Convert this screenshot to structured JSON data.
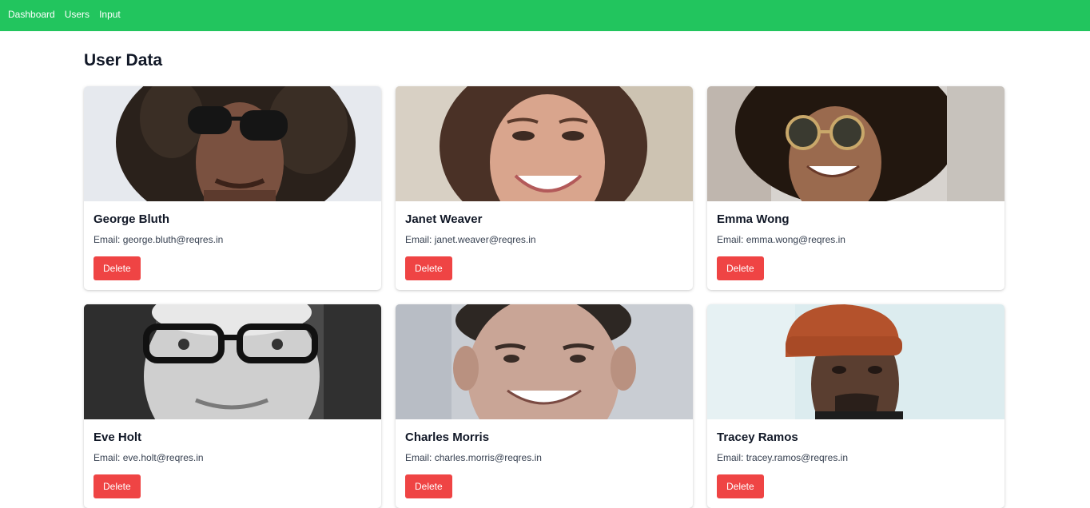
{
  "nav": {
    "items": [
      {
        "label": "Dashboard"
      },
      {
        "label": "Users"
      },
      {
        "label": "Input"
      }
    ]
  },
  "page": {
    "title": "User Data"
  },
  "colors": {
    "navbar": "#22c55e",
    "delete": "#ef4444"
  },
  "users": [
    {
      "name": "George Bluth",
      "email_label": "Email:",
      "email": "george.bluth@reqres.in",
      "delete_label": "Delete"
    },
    {
      "name": "Janet Weaver",
      "email_label": "Email:",
      "email": "janet.weaver@reqres.in",
      "delete_label": "Delete"
    },
    {
      "name": "Emma Wong",
      "email_label": "Email:",
      "email": "emma.wong@reqres.in",
      "delete_label": "Delete"
    },
    {
      "name": "Eve Holt",
      "email_label": "Email:",
      "email": "eve.holt@reqres.in",
      "delete_label": "Delete"
    },
    {
      "name": "Charles Morris",
      "email_label": "Email:",
      "email": "charles.morris@reqres.in",
      "delete_label": "Delete"
    },
    {
      "name": "Tracey Ramos",
      "email_label": "Email:",
      "email": "tracey.ramos@reqres.in",
      "delete_label": "Delete"
    }
  ]
}
